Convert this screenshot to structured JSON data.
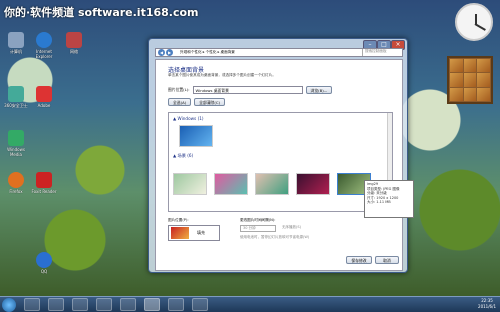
{
  "watermark": "你的·软件频道 software.it168.com",
  "desktop_icons": [
    {
      "label": "计算机",
      "name": "computer",
      "color": "#8aa2c0"
    },
    {
      "label": "Internet Explorer",
      "name": "ie",
      "color": "#2a7ad0"
    },
    {
      "label": "网络",
      "name": "network",
      "color": "#b44"
    },
    {
      "label": "360安全卫士",
      "name": "security",
      "color": "#4a9"
    },
    {
      "label": "Adobe",
      "name": "adobe",
      "color": "#d33"
    },
    {
      "label": "Windows Media",
      "name": "media",
      "color": "#3a6"
    },
    {
      "label": "Firefox",
      "name": "firefox",
      "color": "#e07020"
    },
    {
      "label": "Foxit Reader",
      "name": "foxit",
      "color": "#c22"
    },
    {
      "label": "QQ",
      "name": "qq",
      "color": "#2a6fd0"
    }
  ],
  "window": {
    "breadcrumb": "外观和个性化 ▸ 个性化 ▸ 桌面背景",
    "search_placeholder": "搜索控制面板",
    "heading": "选择桌面背景",
    "description": "单击某个图片使其成为桌面背景，或选择多个图片创建一个幻灯片。",
    "location_label": "图片位置(L):",
    "location_value": "Windows 桌面背景",
    "browse_button": "浏览(B)...",
    "select_all_button": "全选(A)",
    "clear_all_button": "全部清除(C)",
    "group_windows": "▲ Windows (1)",
    "group_scenes": "▲ 场景 (6)",
    "tooltip": [
      "img29",
      "项目类型: JPEG 图像",
      "分级: 未分级",
      "尺寸: 1920 x 1200",
      "大小: 1.11 MB"
    ],
    "position_label": "图片位置(P):",
    "position_value": "填充",
    "interval_label": "更改图片时间间隔(N):",
    "interval_value": "30 分钟",
    "shuffle_label": "无序播放(S)",
    "battery_label": "使用电池时，暂停幻灯片放映可节省电源(W)",
    "save_button": "保存修改",
    "cancel_button": "取消"
  },
  "taskbar": {
    "time": "22:35",
    "date": "2011/6/1"
  }
}
